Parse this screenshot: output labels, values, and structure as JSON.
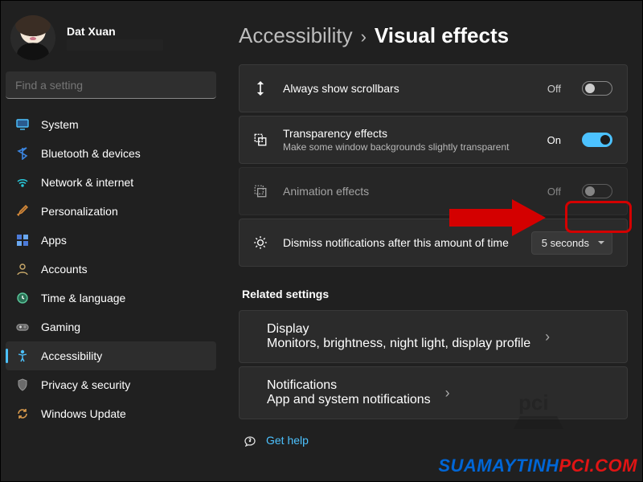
{
  "profile": {
    "name": "Dat Xuan"
  },
  "search": {
    "placeholder": "Find a setting"
  },
  "nav": {
    "items": [
      {
        "label": "System"
      },
      {
        "label": "Bluetooth & devices"
      },
      {
        "label": "Network & internet"
      },
      {
        "label": "Personalization"
      },
      {
        "label": "Apps"
      },
      {
        "label": "Accounts"
      },
      {
        "label": "Time & language"
      },
      {
        "label": "Gaming"
      },
      {
        "label": "Accessibility"
      },
      {
        "label": "Privacy & security"
      },
      {
        "label": "Windows Update"
      }
    ]
  },
  "breadcrumb": {
    "parent": "Accessibility",
    "sep": "›",
    "current": "Visual effects"
  },
  "settings": {
    "scrollbars": {
      "title": "Always show scrollbars",
      "state": "Off"
    },
    "transparency": {
      "title": "Transparency effects",
      "sub": "Make some window backgrounds slightly transparent",
      "state": "On"
    },
    "animation": {
      "title": "Animation effects",
      "state": "Off"
    },
    "dismiss": {
      "title": "Dismiss notifications after this amount of time",
      "value": "5 seconds"
    }
  },
  "related": {
    "heading": "Related settings",
    "display": {
      "title": "Display",
      "sub": "Monitors, brightness, night light, display profile"
    },
    "notifications": {
      "title": "Notifications",
      "sub": "App and system notifications"
    }
  },
  "gethelp": {
    "label": "Get help"
  },
  "watermark": {
    "brand_pre": "SUAMAYTINH",
    "brand_red": "PCI",
    "brand_post": ".COM"
  }
}
